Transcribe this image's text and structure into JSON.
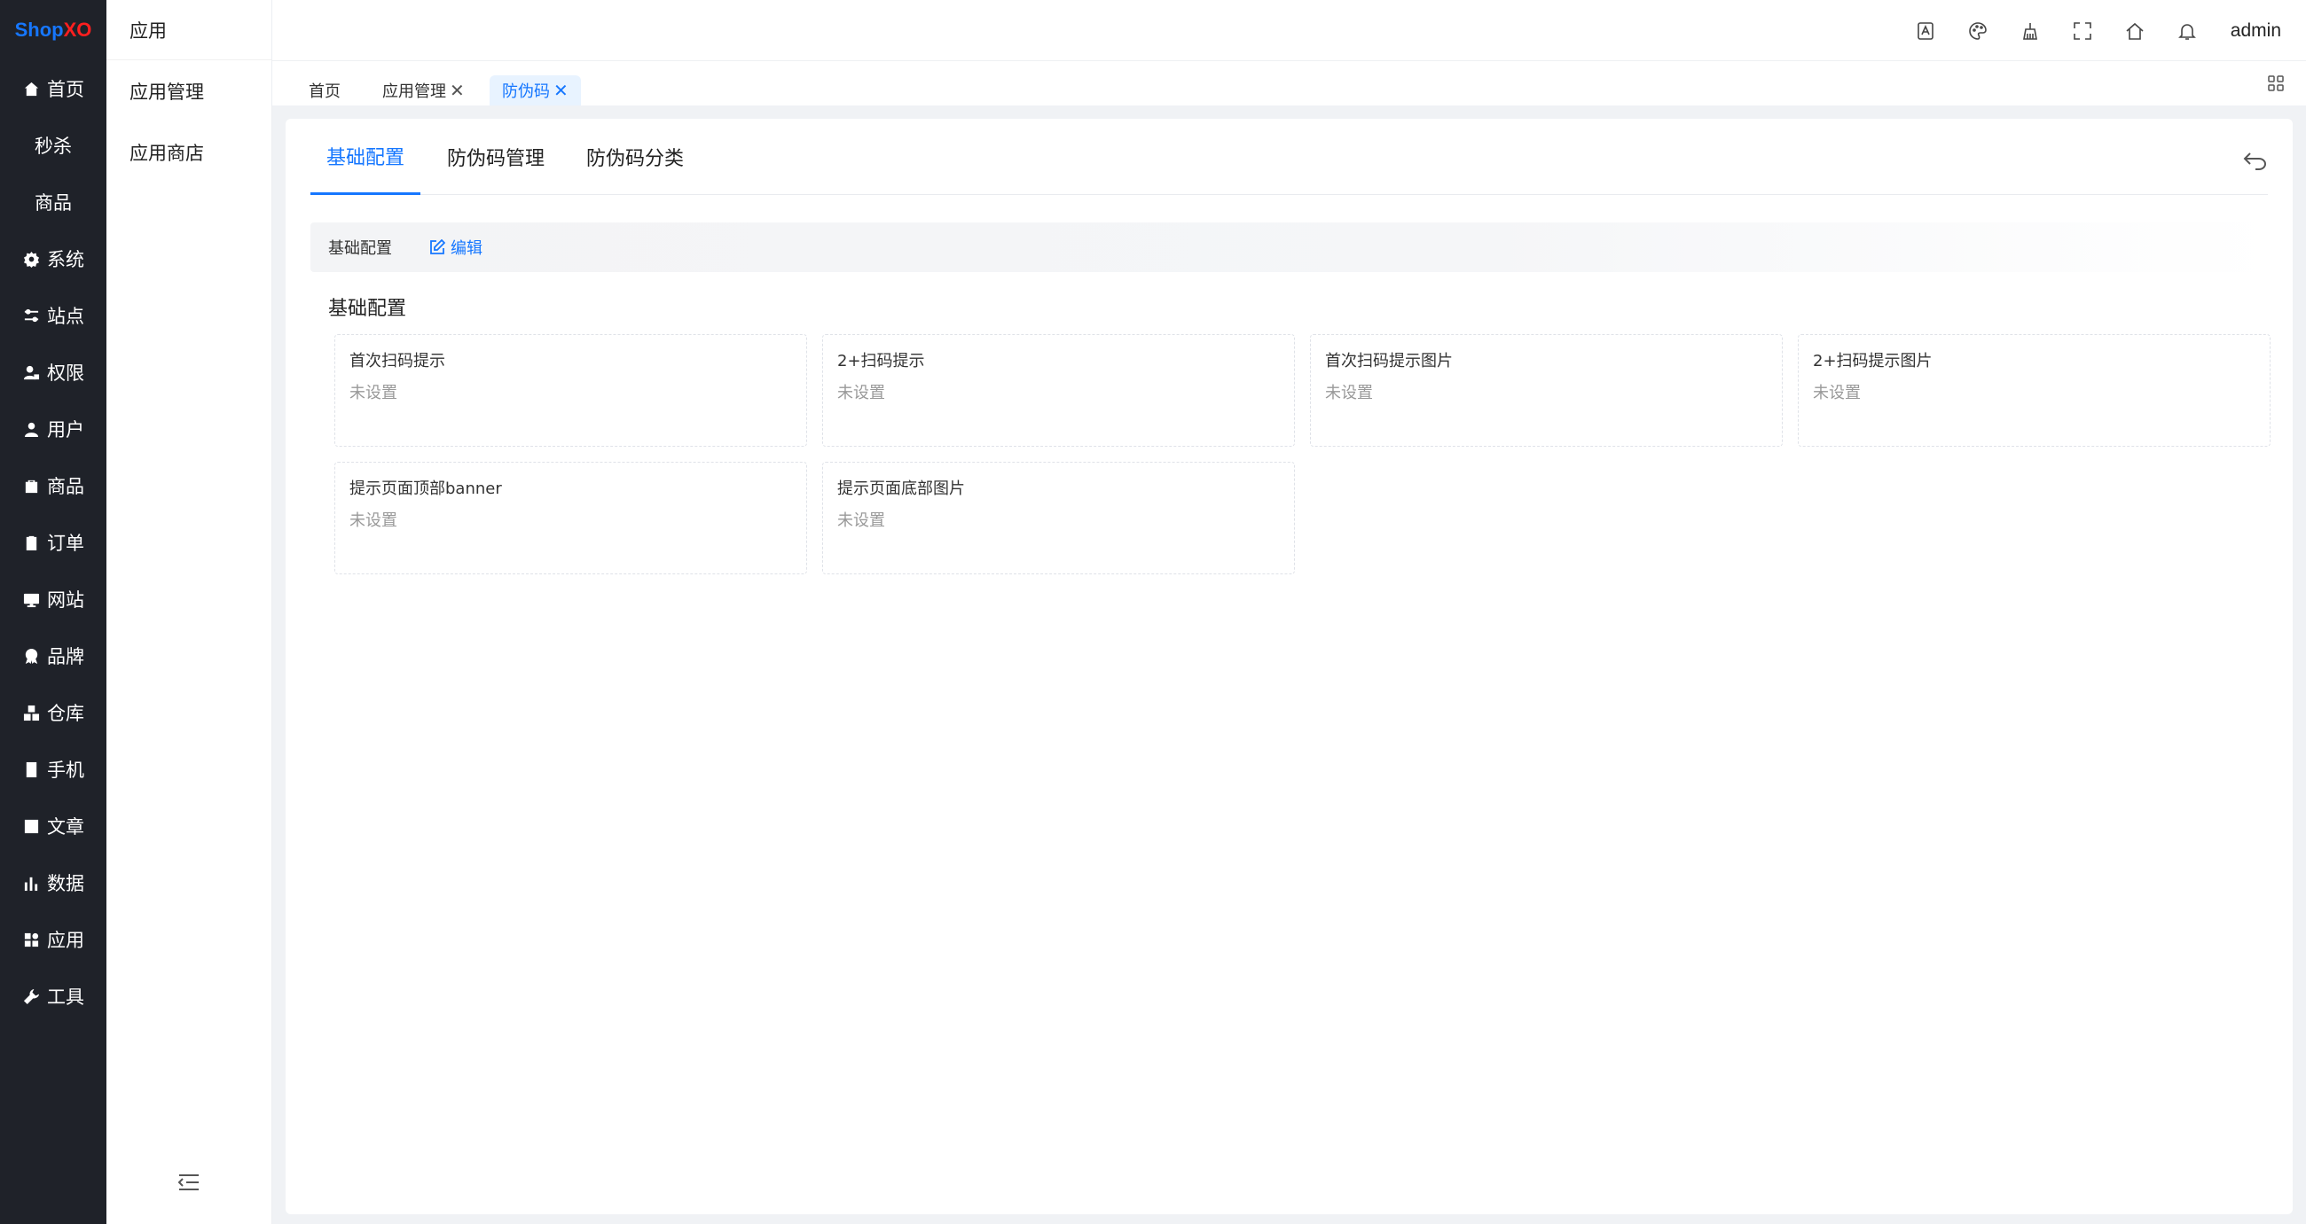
{
  "logo": {
    "part1": "Shop",
    "part2": "XO"
  },
  "rail": [
    {
      "label": "首页",
      "icon": "home-icon"
    },
    {
      "label": "秒杀",
      "icon": ""
    },
    {
      "label": "商品",
      "icon": ""
    },
    {
      "label": "系统",
      "icon": "gear-icon"
    },
    {
      "label": "站点",
      "icon": "sliders-icon"
    },
    {
      "label": "权限",
      "icon": "user-lock-icon"
    },
    {
      "label": "用户",
      "icon": "user-icon"
    },
    {
      "label": "商品",
      "icon": "bag-icon"
    },
    {
      "label": "订单",
      "icon": "clipboard-icon"
    },
    {
      "label": "网站",
      "icon": "monitor-icon"
    },
    {
      "label": "品牌",
      "icon": "award-icon"
    },
    {
      "label": "仓库",
      "icon": "boxes-icon"
    },
    {
      "label": "手机",
      "icon": "phone-icon"
    },
    {
      "label": "文章",
      "icon": "article-icon"
    },
    {
      "label": "数据",
      "icon": "bar-chart-icon"
    },
    {
      "label": "应用",
      "icon": "apps-icon"
    },
    {
      "label": "工具",
      "icon": "wrench-icon"
    }
  ],
  "subnav": {
    "title": "应用",
    "items": [
      "应用管理",
      "应用商店"
    ]
  },
  "header": {
    "icons": [
      "translate-icon",
      "palette-icon",
      "clear-cache-icon",
      "fullscreen-icon",
      "home-icon",
      "bell-icon"
    ],
    "user": "admin"
  },
  "page_tabs": [
    {
      "label": "首页",
      "closable": false
    },
    {
      "label": "应用管理",
      "closable": true,
      "close": "✕"
    },
    {
      "label": "防伪码",
      "closable": true,
      "close": "✕",
      "active": true
    }
  ],
  "content_tabs": [
    "基础配置",
    "防伪码管理",
    "防伪码分类"
  ],
  "section": {
    "bar_title": "基础配置",
    "edit_label": "编辑",
    "group_title": "基础配置"
  },
  "fields": [
    {
      "label": "首次扫码提示",
      "value": "未设置"
    },
    {
      "label": "2+扫码提示",
      "value": "未设置"
    },
    {
      "label": "首次扫码提示图片",
      "value": "未设置"
    },
    {
      "label": "2+扫码提示图片",
      "value": "未设置"
    },
    {
      "label": "提示页面顶部banner",
      "value": "未设置"
    },
    {
      "label": "提示页面底部图片",
      "value": "未设置"
    }
  ],
  "colors": {
    "accent": "#1677ff",
    "rail_bg": "#1f2229",
    "logo_red": "#ff1f1f"
  }
}
